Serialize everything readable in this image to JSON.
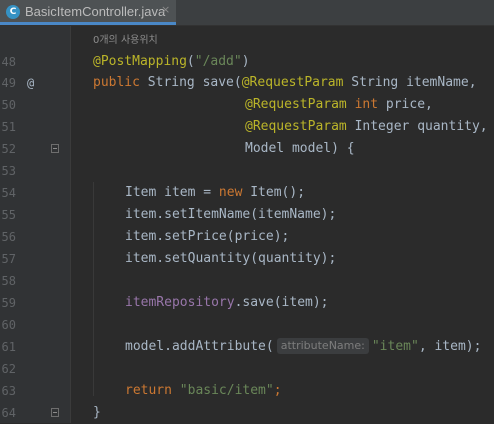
{
  "tab": {
    "icon_letter": "C",
    "file_name": "BasicItemController.java",
    "close_symbol": "×"
  },
  "usage_hint": "0개의 사용위치",
  "gutter": {
    "line_numbers": [
      "48",
      "49",
      "50",
      "51",
      "52",
      "53",
      "54",
      "55",
      "56",
      "57",
      "58",
      "59",
      "60",
      "61",
      "62",
      "63",
      "64"
    ],
    "annotation_marker": "@"
  },
  "code": {
    "l48": {
      "annotation": "@PostMapping",
      "open": "(",
      "path": "\"/add\"",
      "close": ")"
    },
    "l49": {
      "modifier": "public",
      "sig": " String save(",
      "annotation": "@RequestParam",
      "param": " String itemName,"
    },
    "l50": {
      "annotation": "@RequestParam",
      "type_kw": " int",
      "param": " price,"
    },
    "l51": {
      "annotation": "@RequestParam",
      "param": " Integer quantity,"
    },
    "l52": {
      "text": "Model model) {"
    },
    "l54": {
      "decl": "Item item = ",
      "new_kw": "new",
      "ctor": " Item();"
    },
    "l55": {
      "text": "item.setItemName(itemName);"
    },
    "l56": {
      "text": "item.setPrice(price);"
    },
    "l57": {
      "text": "item.setQuantity(quantity);"
    },
    "l59": {
      "field": "itemRepository",
      "call": ".save(item);"
    },
    "l61": {
      "call": "model.addAttribute(",
      "param_hint": "attributeName:",
      "arg": "\"item\"",
      "rest": ", item);"
    },
    "l63": {
      "return_kw": "return",
      "value": " \"basic/item\"",
      "end": ";"
    },
    "l64": {
      "text": "}"
    }
  },
  "colors": {
    "background": "#2b2b2b",
    "gutter": "#313335",
    "annotation": "#bbb529",
    "keyword": "#cc7832",
    "string": "#6a8759",
    "field": "#9876aa",
    "text": "#a9b7c6",
    "tab_underline": "#4a88c7"
  }
}
